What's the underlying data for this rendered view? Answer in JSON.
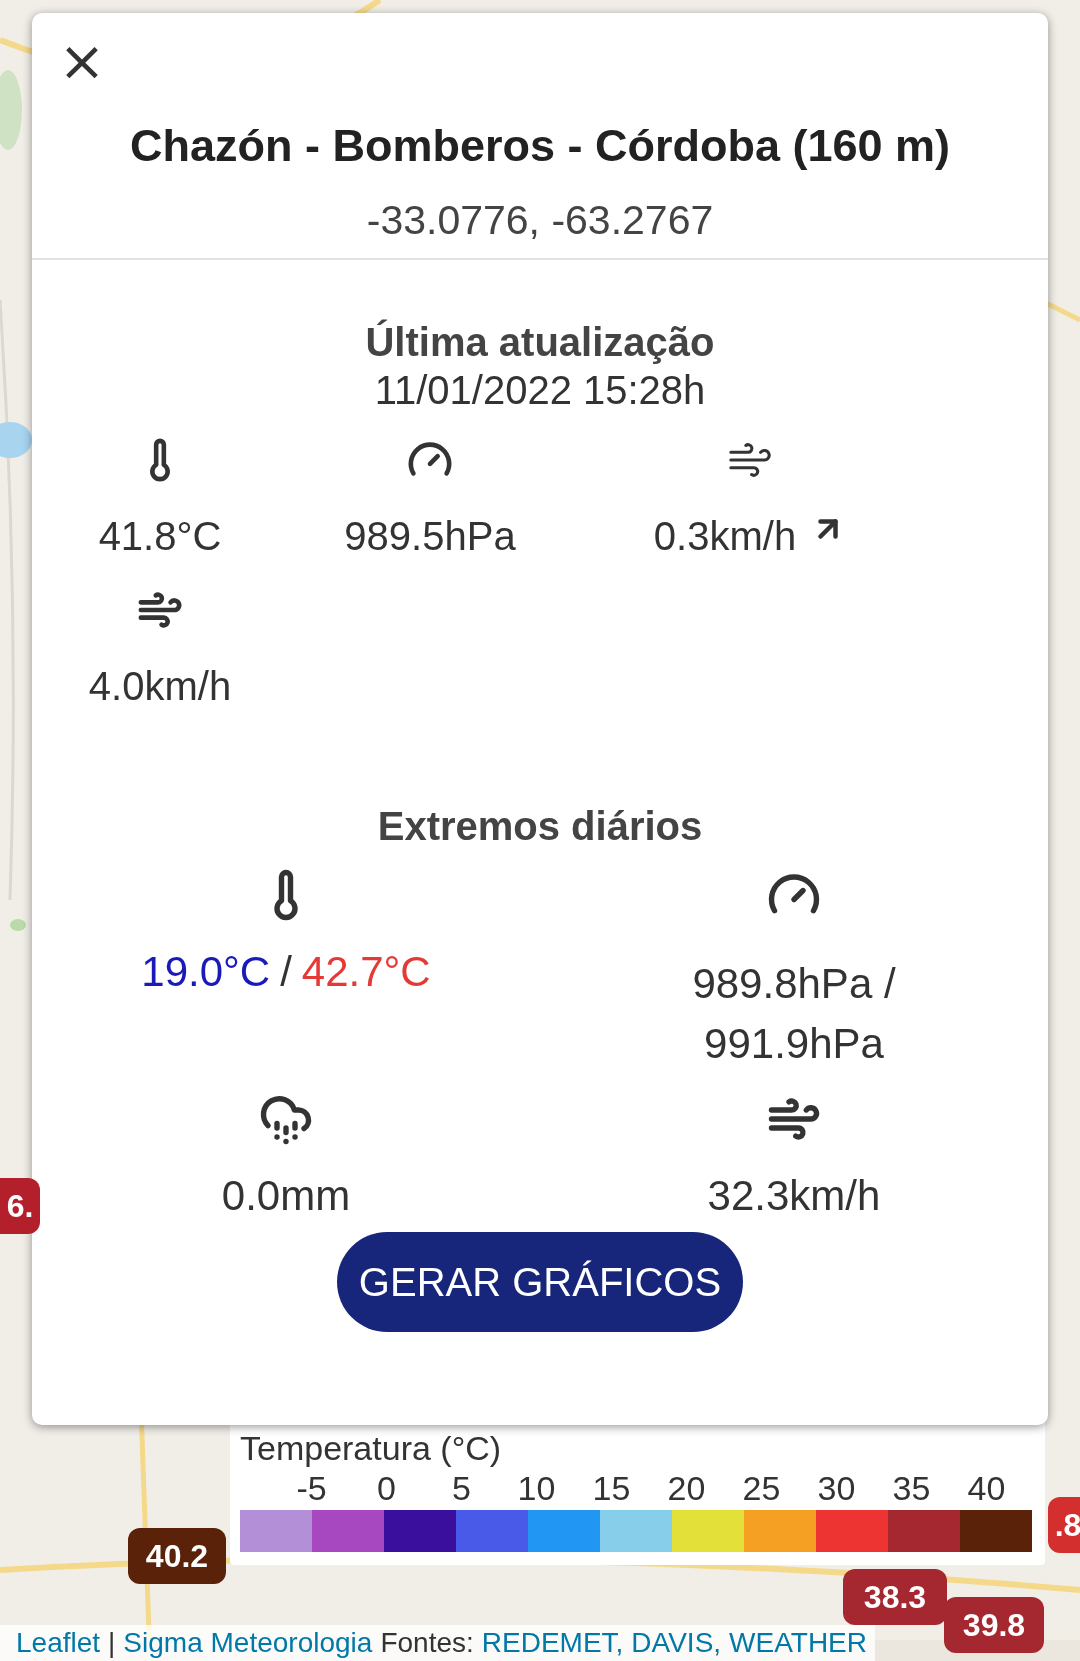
{
  "dialog": {
    "close": "×",
    "title": "Chazón - Bomberos - Córdoba (160 m)",
    "coordinates": "-33.0776, -63.2767",
    "current": {
      "heading": "Última atualização",
      "timestamp": "11/01/2022 15:28h",
      "readings": [
        {
          "kind": "temperature",
          "value": "41.8°C"
        },
        {
          "kind": "pressure",
          "value": "989.5hPa"
        },
        {
          "kind": "wind",
          "value": "0.3km/h"
        },
        {
          "kind": "gust",
          "value": "4.0km/h"
        }
      ]
    },
    "extremes": {
      "heading": "Extremos diários",
      "temperature": {
        "min": "19.0°C",
        "separator": "/",
        "max": "42.7°C"
      },
      "pressure": {
        "lines": [
          "989.8hPa /",
          "991.9hPa"
        ]
      },
      "rain": "0.0mm",
      "gust": "32.3km/h"
    },
    "button": "GERAR GRÁFICOS"
  },
  "legend": {
    "title": "Temperatura (°C)",
    "ticks": [
      "-5",
      "0",
      "5",
      "10",
      "15",
      "20",
      "25",
      "30",
      "35",
      "40"
    ],
    "swatches": [
      {
        "color": "#b28fd6"
      },
      {
        "color": "#a848c0"
      },
      {
        "color": "#3a0f9e"
      },
      {
        "color": "#4a5ae8"
      },
      {
        "color": "#2196f3"
      },
      {
        "color": "#87ceeb"
      },
      {
        "color": "#e3e03a"
      },
      {
        "color": "#f5a023"
      },
      {
        "color": "#ee3333"
      },
      {
        "color": "#a52831"
      },
      {
        "color": "#5a2309"
      }
    ]
  },
  "markers": [
    {
      "label": "6.",
      "color": "#b3202c"
    },
    {
      "label": "40.2",
      "color": "#5a2309"
    },
    {
      "label": "38.3",
      "color": "#a52831"
    },
    {
      "label": ".8",
      "color": "#d32f2f"
    },
    {
      "label": "39.8",
      "color": "#a52831"
    }
  ],
  "attribution": [
    {
      "kind": "link",
      "text": "Leaflet"
    },
    {
      "kind": "text",
      "text": "|"
    },
    {
      "kind": "link",
      "text": "Sigma Meteorologia"
    },
    {
      "kind": "text",
      "text": "Fontes:"
    },
    {
      "kind": "link",
      "text": "REDEMET,"
    },
    {
      "kind": "link",
      "text": "DAVIS,"
    },
    {
      "kind": "link",
      "text": "WEATHER"
    }
  ]
}
